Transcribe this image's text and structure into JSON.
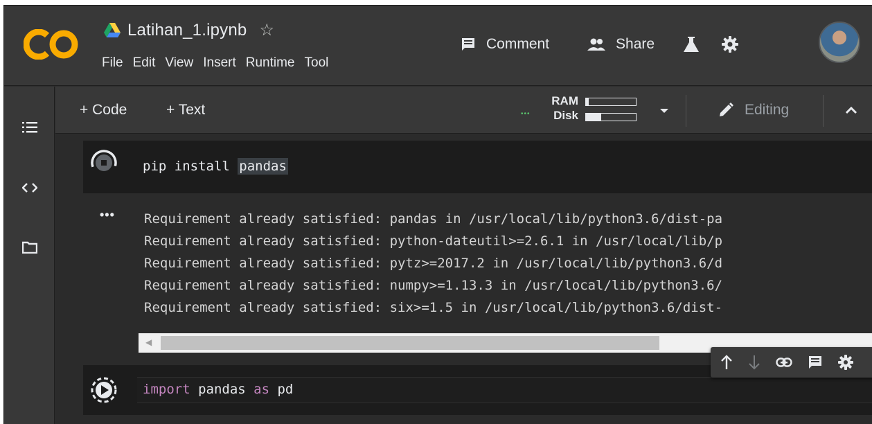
{
  "notebook": {
    "title": "Latihan_1.ipynb",
    "menu": [
      "File",
      "Edit",
      "View",
      "Insert",
      "Runtime",
      "Tool"
    ]
  },
  "header": {
    "comment_label": "Comment",
    "share_label": "Share"
  },
  "toolbar": {
    "add_code_label": "+ Code",
    "add_text_label": "+ Text",
    "ram_label": "RAM",
    "disk_label": "Disk",
    "ram_usage": 0.05,
    "disk_usage": 0.3,
    "editing_label": "Editing",
    "colors": {
      "connected": "#5ac26d"
    }
  },
  "cells": {
    "cell1": {
      "code_prefix": "pip install ",
      "code_highlight": "pandas"
    },
    "cell1_output": {
      "lines": [
        "Requirement already satisfied: pandas in /usr/local/lib/python3.6/dist-pa",
        "Requirement already satisfied: python-dateutil>=2.6.1 in /usr/local/lib/p",
        "Requirement already satisfied: pytz>=2017.2 in /usr/local/lib/python3.6/d",
        "Requirement already satisfied: numpy>=1.13.3 in /usr/local/lib/python3.6/",
        "Requirement already satisfied: six>=1.5 in /usr/local/lib/python3.6/dist-"
      ]
    },
    "cell2": {
      "kw1": "import",
      "name1": " pandas ",
      "kw2": "as",
      "name2": " pd"
    }
  },
  "icons": {
    "rail": [
      "table-of-contents-icon",
      "code-snippets-icon",
      "files-icon"
    ],
    "cell_toolbar": [
      "move-up-icon",
      "move-down-icon",
      "link-icon",
      "comment-icon",
      "settings-icon"
    ]
  }
}
